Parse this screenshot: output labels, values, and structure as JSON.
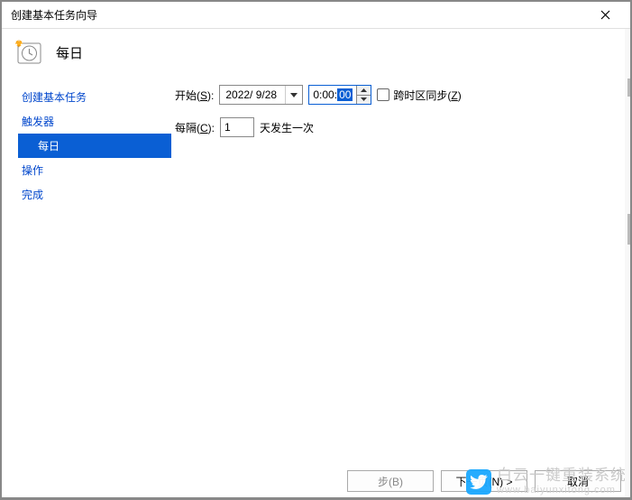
{
  "window": {
    "title": "创建基本任务向导"
  },
  "header": {
    "title": "每日"
  },
  "sidebar": {
    "items": [
      {
        "label": "创建基本任务",
        "indent": false,
        "selected": false
      },
      {
        "label": "触发器",
        "indent": false,
        "selected": false
      },
      {
        "label": "每日",
        "indent": true,
        "selected": true
      },
      {
        "label": "操作",
        "indent": false,
        "selected": false
      },
      {
        "label": "完成",
        "indent": false,
        "selected": false
      }
    ]
  },
  "form": {
    "start_label_pre": "开始(",
    "start_label_key": "S",
    "start_label_post": "):",
    "date_value": "2022/ 9/28",
    "time_prefix": "0:00:",
    "time_selected": "00",
    "sync_label_pre": "跨时区同步(",
    "sync_label_key": "Z",
    "sync_label_post": ")",
    "recur_label_pre": "每隔(",
    "recur_label_key": "C",
    "recur_label_post": "):",
    "recur_value": "1",
    "recur_suffix": "天发生一次"
  },
  "footer": {
    "back_pre": "步(",
    "back_key": "B",
    "back_post": ")",
    "next_pre": "下一页(",
    "next_key": "N",
    "next_post": ") >",
    "cancel": "取消"
  },
  "watermark": {
    "text": "白云一键重装系统",
    "url": "www.baiyunxitong.com"
  }
}
